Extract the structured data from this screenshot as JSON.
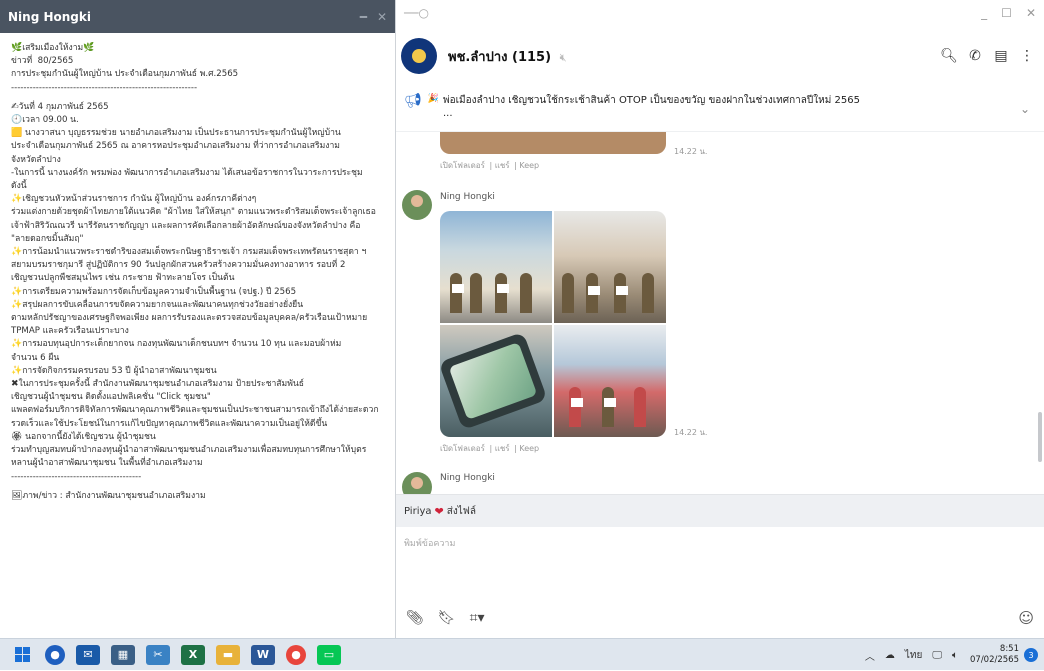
{
  "note": {
    "title": "Ning Hongki",
    "lines": [
      {
        "icon": "🌿",
        "text": "เสริมเมืองให้งาม",
        "tail": "🌿"
      },
      {
        "text": "ข่าวที่  80/2565"
      },
      {
        "text": "การประชุมกำนันผู้ใหญ่บ้าน ประจำเดือนกุมภาพันธ์ พ.ศ.2565"
      },
      {
        "text": "------------------------------------------------------------"
      },
      {
        "gap": true
      },
      {
        "icon": "✍",
        "text": "วันที่ 4 กุมภาพันธ์ 2565"
      },
      {
        "icon": "🕘",
        "text": "เวลา 09.00 น."
      },
      {
        "icon": "🟨",
        "text": " นางวาสนา บุญธรรมช่วย นายอำเภอเสริมงาม เป็นประธานการประชุมกำนันผู้ใหญ่บ้าน"
      },
      {
        "text": "ประจำเดือนกุมภาพันธ์ 2565 ณ อาคารหอประชุมอำเภอเสริมงาม ที่ว่าการอำเภอเสริมงาม"
      },
      {
        "text": "จังหวัดลำปาง"
      },
      {
        "text": "-ในการนี้ นางนงค์รัก พรมพ่อง พัฒนาการอำเภอเสริมงาม ได้เสนอข้อราชการในวาระการประชุม"
      },
      {
        "text": "ดังนี้"
      },
      {
        "icon": "✨",
        "text": "เชิญชวนหัวหน้าส่วนราชการ กำนัน ผู้ใหญ่บ้าน องค์กรภาคีต่างๆ"
      },
      {
        "text": "ร่วมแต่งกายด้วยชุดผ้าไทยภายใต้แนวคิด \"ผ้าไทย ใส่ให้สนุก\" ตามแนวพระดำริสมเด็จพระเจ้าลูกเธอ"
      },
      {
        "text": "เจ้าฟ้าสิริวัณณวรี นารีรัตนราชกัญญา และผลการคัดเลือกลายผ้าอัตลักษณ์ของจังหวัดลำปาง คือ"
      },
      {
        "text": "\"ลายดอกขมิ้นสัมฤ\""
      },
      {
        "icon": "✨",
        "text": "การน้อมนำแนวพระราชดำริของสมเด็จพระกนิษฐาธิราชเจ้า กรมสมเด็จพระเทพรัตนราชสุดา ฯ"
      },
      {
        "text": "สยามบรมราชกุมารี สู่ปฏิบัติการ 90 วันปลูกผักสวนครัวสร้างความมั่นคงทางอาหาร รอบที่ 2"
      },
      {
        "text": "เชิญชวนปลูกพืชสมุนไพร เช่น กระชาย ฟ้าทะลายโจร เป็นต้น"
      },
      {
        "icon": "✨",
        "text": "การเตรียมความพร้อมการจัดเก็บข้อมูลความจำเป็นพื้นฐาน (จปฐ.) ปี 2565"
      },
      {
        "icon": "✨",
        "text": "สรุปผลการขับเคลื่อนการขจัดความยากจนและพัฒนาคนทุกช่วงวัยอย่างยั่งยืน"
      },
      {
        "text": "ตามหลักปรัชญาของเศรษฐกิจพอเพียง ผลการรับรองและตรวจสอบข้อมูลบุคคล/ครัวเรือนเป้าหมาย"
      },
      {
        "text": "TPMAP และครัวเรือนเปราะบาง"
      },
      {
        "icon": "✨",
        "text": "การมอบทุนอุปการะเด็กยากจน กองทุนพัฒนาเด็กชนบทฯ จำนวน 10 ทุน และมอบผ้าห่ม"
      },
      {
        "text": "จำนวน 6 ผืน"
      },
      {
        "icon": "✨",
        "text": "การจัดกิจกรรมครบรอบ 53 ปี ผู้นำอาสาพัฒนาชุมชน"
      },
      {
        "icon": "✖",
        "text": "ในการประชุมครั้งนี้ สำนักงานพัฒนาชุมชนอำเภอเสริมงาม ป้ายประชาสัมพันธ์"
      },
      {
        "text": "เชิญชวนผู้นำชุมชน ติดตั้งแอปพลิเคชั่น \"Click ชุมชน\""
      },
      {
        "text": "แพลตฟอร์มบริการดิจิทัลการพัฒนาคุณภาพชีวิตและชุมชนเป็นประชาชนสามารถเข้าถึงได้ง่ายสะดวก"
      },
      {
        "text": "รวดเร็วและใช้ประโยชน์ในการแก้ไขปัญหาคุณภาพชีวิตและพัฒนาความเป็นอยู่ให้ดีขึ้น"
      },
      {
        "icon": "🏵",
        "text": " นอกจากนี้ยังได้เชิญชวน ผู้นำชุมชน"
      },
      {
        "text": "ร่วมทำบุญสมทบผ้าป่ากองทุนผู้นำอาสาพัฒนาชุมชนอำเภอเสริมงามเพื่อสมทบทุนการศึกษาให้บุตร"
      },
      {
        "text": "หลานผู้นำอาสาพัฒนาชุมชน ในพื้นที่อำเภอเสริมงาม"
      },
      {
        "text": "------------------------------------------"
      },
      {
        "gap": true
      },
      {
        "icon": "🖼",
        "text": "ภาพ/ข่าว : สำนักงานพัฒนาชุมชนอำเภอเสริมงาม"
      }
    ]
  },
  "chat": {
    "group_name": "พช.ลำปาง (115)",
    "announcement": "พ่อเมืองลำปาง เชิญชวนใช้กระเช้าสินค้า OTOP เป็นของขวัญ ของฝากในช่วงเทศกาลปีใหม่ 2565",
    "announcement_more": "...",
    "messages": [
      {
        "time": "14.22 น.",
        "actions": [
          "เปิดโฟลเดอร์",
          "แชร์",
          "Keep"
        ]
      },
      {
        "sender": "Ning Hongki",
        "time": "14.22 น.",
        "actions": [
          "เปิดโฟลเดอร์",
          "แชร์",
          "Keep"
        ]
      },
      {
        "sender": "Ning Hongki"
      }
    ],
    "reply_name": "Piriya",
    "reply_text": "ส่งไฟล์",
    "input_placeholder": "พิมพ์ข้อความ"
  },
  "taskbar": {
    "tray_lang": "ไทย",
    "clock_time": "8:51",
    "clock_date": "07/02/2565",
    "notif_count": "3"
  }
}
